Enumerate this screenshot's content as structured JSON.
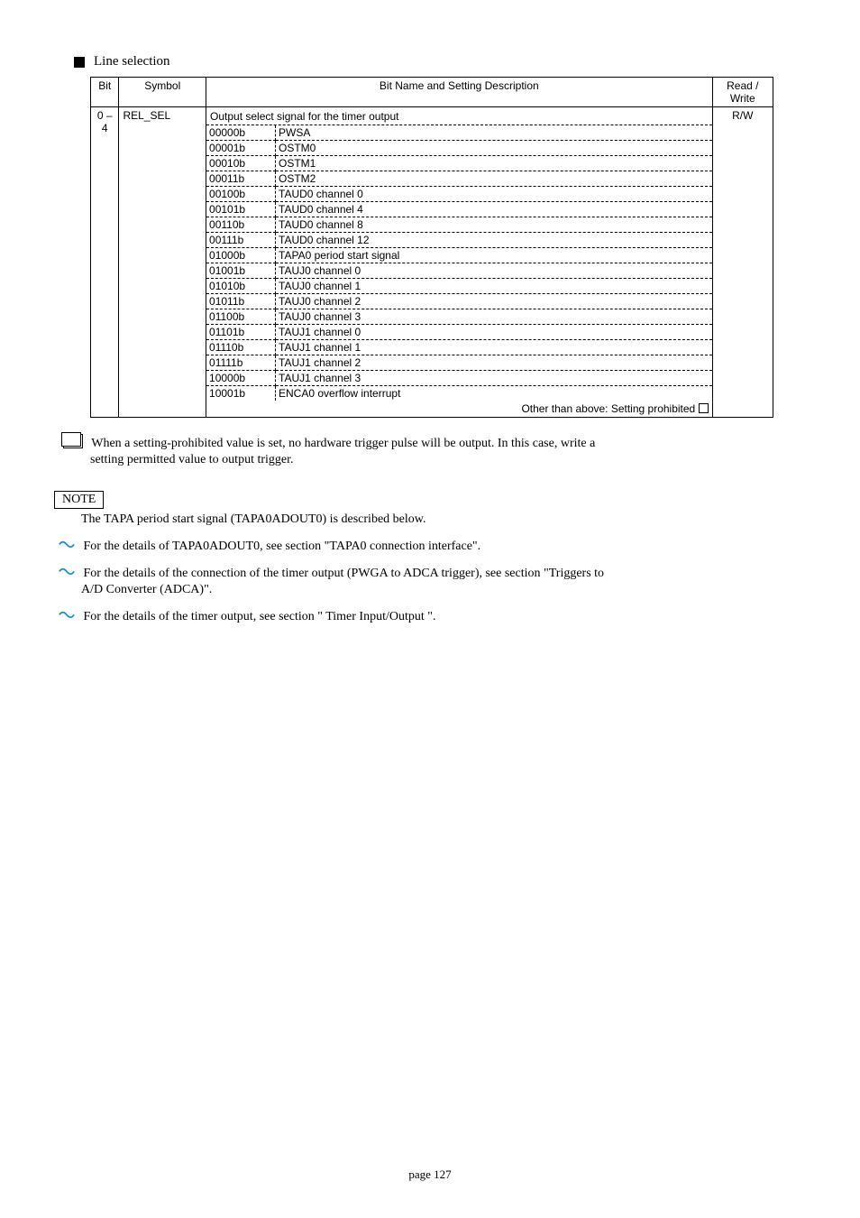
{
  "section": {
    "title": "Line selection"
  },
  "table": {
    "headers": {
      "bit": "Bit",
      "symbol": "Symbol",
      "name": "Bit Name and Setting Description",
      "rw": "Read / Write"
    },
    "row_bit": "0 – 4",
    "row_symbol": "REL_SEL",
    "row_rw": "R/W",
    "title": "Output select signal for the timer output",
    "options": [
      {
        "code": "00000b",
        "desc": "PWSA"
      },
      {
        "code": "00001b",
        "desc": "OSTM0"
      },
      {
        "code": "00010b",
        "desc": "OSTM1"
      },
      {
        "code": "00011b",
        "desc": "OSTM2"
      },
      {
        "code": "00100b",
        "desc": "TAUD0 channel 0"
      },
      {
        "code": "00101b",
        "desc": "TAUD0 channel 4"
      },
      {
        "code": "00110b",
        "desc": "TAUD0 channel 8"
      },
      {
        "code": "00111b",
        "desc": "TAUD0 channel 12"
      },
      {
        "code": "01000b",
        "desc": "TAPA0 period start signal"
      },
      {
        "code": "01001b",
        "desc": "TAUJ0 channel 0"
      },
      {
        "code": "01010b",
        "desc": "TAUJ0 channel 1"
      },
      {
        "code": "01011b",
        "desc": "TAUJ0 channel 2"
      },
      {
        "code": "01100b",
        "desc": "TAUJ0 channel 3"
      },
      {
        "code": "01101b",
        "desc": "TAUJ1 channel 0"
      },
      {
        "code": "01110b",
        "desc": "TAUJ1 channel 1"
      },
      {
        "code": "01111b",
        "desc": "TAUJ1 channel 2"
      },
      {
        "code": "10000b",
        "desc": "TAUJ1 channel 3"
      },
      {
        "code": "10001b",
        "desc": "ENCA0 overflow interrupt"
      }
    ],
    "last_line": "Other than above: Setting prohibited"
  },
  "box_note": {
    "line1": "When a setting-prohibited value is set, no hardware trigger pulse will be output. In this case, write a",
    "line2": "setting permitted value to output trigger."
  },
  "note_label": "NOTE",
  "note_text": "The TAPA period start signal (TAPA0ADOUT0) is described below.",
  "links": {
    "l1": "For the details of TAPA0ADOUT0, see section \"TAPA0 connection interface\".",
    "l2_a": "For the details of the connection of the timer output (PWGA to ADCA trigger), see section \"Triggers to",
    "l2_b": "A/D Converter (ADCA)\".",
    "l3_a": "For the details",
    "l3_mid_plain": " of the timer output, see section \"",
    "l3_mid_link": "Timer Input/Output",
    "l3_close_plain": "\"."
  },
  "footer": "page 127"
}
